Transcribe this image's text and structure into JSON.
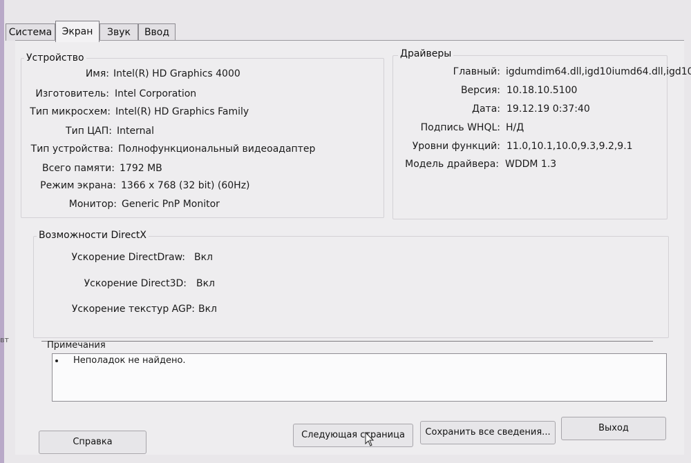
{
  "side": {
    "text": "вт"
  },
  "tabs": [
    {
      "label": "Система"
    },
    {
      "label": "Экран"
    },
    {
      "label": "Звук"
    },
    {
      "label": "Ввод"
    }
  ],
  "device": {
    "title": "Устройство",
    "rows": [
      {
        "label": "Имя:",
        "value": "Intel(R) HD Graphics 4000"
      },
      {
        "label": "Изготовитель:",
        "value": "Intel Corporation"
      },
      {
        "label": "Тип микросхем:",
        "value": "Intel(R) HD Graphics Family"
      },
      {
        "label": "Тип ЦАП:",
        "value": "Internal"
      },
      {
        "label": "Тип устройства:",
        "value": "Полнофункциональный видеоадаптер"
      },
      {
        "label": "Всего памяти:",
        "value": "1792 MB"
      },
      {
        "label": "Режим экрана:",
        "value": "1366 x 768 (32 bit) (60Hz)"
      },
      {
        "label": "Монитор:",
        "value": "Generic PnP Monitor"
      }
    ]
  },
  "drivers": {
    "title": "Драйверы",
    "rows": [
      {
        "label": "Главный:",
        "value": "igdumdim64.dll,igd10iumd64.dll,igd10"
      },
      {
        "label": "Версия:",
        "value": "10.18.10.5100"
      },
      {
        "label": "Дата:",
        "value": "19.12.19 0:37:40"
      },
      {
        "label": "Подпись WHQL:",
        "value": "Н/Д"
      },
      {
        "label": "Уровни функций:",
        "value": "11.0,10.1,10.0,9.3,9.2,9.1"
      },
      {
        "label": "Модель драйвера:",
        "value": "WDDM 1.3"
      }
    ]
  },
  "directx": {
    "title": "Возможности DirectX",
    "rows": [
      {
        "label": "Ускорение DirectDraw:",
        "value": "Вкл"
      },
      {
        "label": "Ускорение Direct3D:",
        "value": "Вкл"
      },
      {
        "label": "Ускорение текстур AGP:",
        "value": "Вкл"
      }
    ]
  },
  "notes": {
    "title": "Примечания",
    "items": [
      "Неполадок не найдено."
    ]
  },
  "buttons": {
    "help": "Справка",
    "next": "Следующая страница",
    "save": "Сохранить все сведения...",
    "exit": "Выход"
  }
}
